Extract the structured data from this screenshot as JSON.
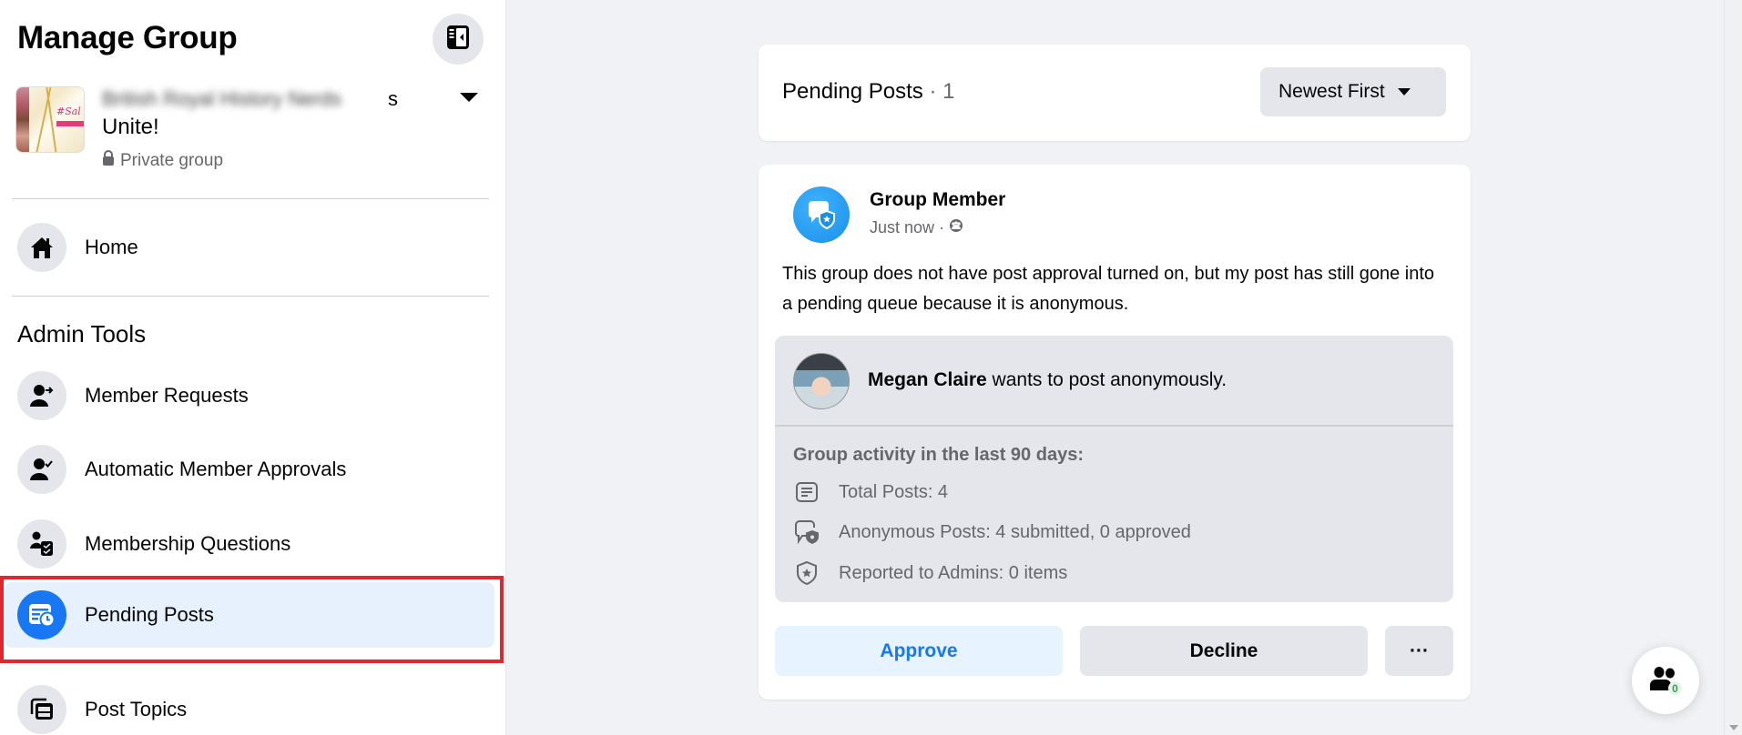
{
  "sidebar": {
    "title": "Manage Group",
    "collapse_icon": "sidebar-collapse-icon",
    "group": {
      "name_line1_blurred": "British Royal History Nerds",
      "name_line1_suffix": "s",
      "name_line2": "Unite!",
      "privacy": "Private group",
      "privacy_icon": "lock-icon"
    },
    "home": {
      "label": "Home",
      "icon": "home-icon"
    },
    "section_title": "Admin Tools",
    "items": [
      {
        "label": "Member Requests",
        "icon": "person-arrow-icon"
      },
      {
        "label": "Automatic Member Approvals",
        "icon": "person-check-icon"
      },
      {
        "label": "Membership Questions",
        "icon": "person-clipboard-icon"
      },
      {
        "label": "Pending Posts",
        "icon": "pending-posts-icon",
        "active": true
      },
      {
        "label": "Post Topics",
        "icon": "post-topics-icon"
      }
    ]
  },
  "main": {
    "header": {
      "title": "Pending Posts",
      "separator": " · ",
      "count": "1",
      "sort_label": "Newest First"
    },
    "post": {
      "author": "Group Member",
      "time": "Just now",
      "meta_separator": "·",
      "audience_icon": "group-audience-icon",
      "body": "This group does not have post approval turned on, but my post has still gone into a pending queue because it is anonymous.",
      "anonymous_request": {
        "name": "Megan Claire",
        "text": " wants to post anonymously."
      },
      "activity": {
        "title": "Group activity in the last 90 days:",
        "rows": [
          {
            "icon": "post-list-icon",
            "text": "Total Posts: 4"
          },
          {
            "icon": "anonymous-chat-icon",
            "text": "Anonymous Posts: 4 submitted, 0 approved"
          },
          {
            "icon": "shield-star-icon",
            "text": "Reported to Admins: 0 items"
          }
        ]
      },
      "actions": {
        "approve": "Approve",
        "decline": "Decline",
        "more": "···"
      }
    }
  },
  "floating": {
    "icon": "people-icon",
    "count": "0"
  },
  "colors": {
    "accent": "#1877f2",
    "highlight_outline": "#e0262f",
    "active_bg": "#e7f0fd",
    "badge_green": "#31a24c"
  }
}
